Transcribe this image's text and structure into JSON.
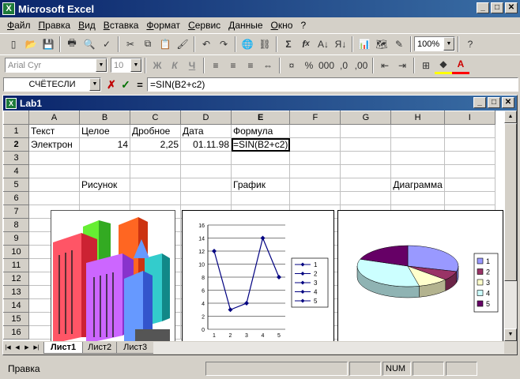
{
  "app": {
    "title": "Microsoft Excel"
  },
  "menu": [
    "Файл",
    "Правка",
    "Вид",
    "Вставка",
    "Формат",
    "Сервис",
    "Данные",
    "Окно",
    "?"
  ],
  "toolbar": {
    "zoom": "100%",
    "font": "Arial Cyr",
    "font_size": "10"
  },
  "formula_bar": {
    "name_box": "СЧЁТЕСЛИ",
    "cancel": "✗",
    "enter": "✓",
    "equals": "=",
    "formula": "=SIN(B2+c2)"
  },
  "workbook": {
    "title": "Lab1"
  },
  "columns": [
    "A",
    "B",
    "C",
    "D",
    "E",
    "F",
    "G",
    "H",
    "I"
  ],
  "rows": [
    "1",
    "2",
    "3",
    "4",
    "5",
    "6",
    "7",
    "8",
    "9",
    "10",
    "11",
    "12",
    "13",
    "14",
    "15",
    "16"
  ],
  "cells": {
    "A1": "Текст",
    "B1": "Целое",
    "C1": "Дробное",
    "D1": "Дата",
    "E1": "Формула",
    "A2": "Электрон",
    "B2": "14",
    "C2": "2,25",
    "D2": "01.11.98",
    "E2": "=SIN(B2+c2)",
    "B5": "Рисунок",
    "E5": "График",
    "H5": "Диаграмма"
  },
  "sheets": [
    "Лист1",
    "Лист2",
    "Лист3"
  ],
  "active_sheet": "Лист1",
  "status": {
    "text": "Правка",
    "num": "NUM"
  },
  "chart_data": [
    {
      "type": "line",
      "x": [
        1,
        2,
        3,
        4,
        5
      ],
      "values": [
        12,
        3,
        4,
        14,
        8
      ],
      "ylim": [
        0,
        16
      ],
      "yticks": [
        0,
        2,
        4,
        6,
        8,
        10,
        12,
        14,
        16
      ],
      "legend": [
        "1",
        "2",
        "3",
        "4",
        "5"
      ],
      "legend_position": "right",
      "grid": true,
      "color": "#000080"
    },
    {
      "type": "pie",
      "categories": [
        "1",
        "2",
        "3",
        "4",
        "5"
      ],
      "values": [
        12,
        3,
        4,
        14,
        8
      ],
      "colors": [
        "#9999ff",
        "#993366",
        "#ffffcc",
        "#ccffff",
        "#660066"
      ],
      "legend_position": "right"
    }
  ]
}
